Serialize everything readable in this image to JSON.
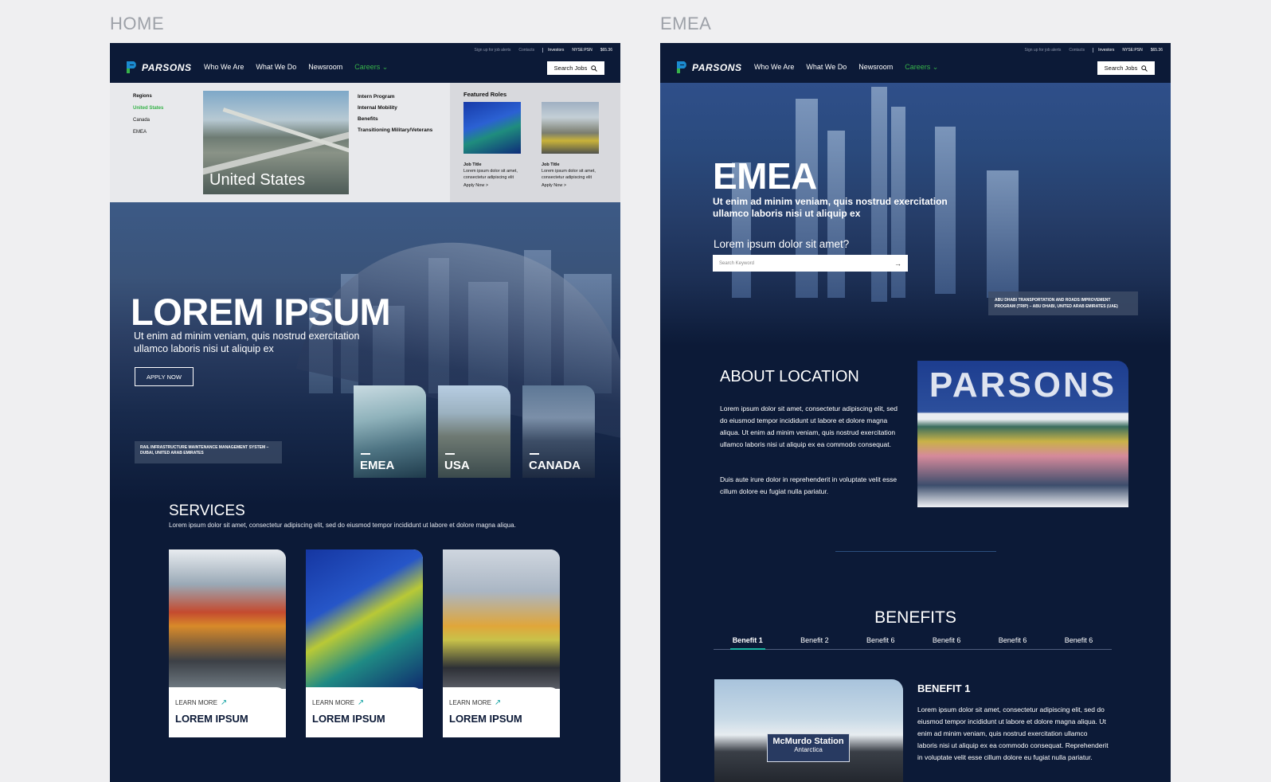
{
  "board_labels": {
    "home": "HOME",
    "emea": "EMEA"
  },
  "nav": {
    "utility": [
      "Sign up for job alerts",
      "Contacts",
      "Investors",
      "NYSE:PSN",
      "$65.36"
    ],
    "logo": "PARSONS",
    "menu": [
      "Who We Are",
      "What We Do",
      "Newsroom",
      "Careers"
    ],
    "careers_chevron": "⌄",
    "search_label": "Search Jobs"
  },
  "mega_menu": {
    "regions_heading": "Regions",
    "regions": [
      "United States",
      "Canada",
      "EMEA"
    ],
    "image_caption": "United States",
    "links": [
      "Intern Program",
      "Internal Mobility",
      "Benefits",
      "Transitioning Military/Veterans"
    ],
    "featured_title": "Featured Roles",
    "roles": [
      {
        "title": "Job Title",
        "desc": "Lorem ipsum dolor sit amet, consectetur adipiscing elit",
        "apply": "Apply Now >"
      },
      {
        "title": "Job Title",
        "desc": "Lorem ipsum dolor sit amet, consectetur adipiscing elit",
        "apply": "Apply Now >"
      }
    ]
  },
  "home_hero": {
    "title": "LOREM IPSUM",
    "subtitle": "Ut enim ad minim veniam, quis nostrud exercitation ullamco laboris nisi ut aliquip ex",
    "button": "APPLY NOW",
    "caption": "RAIL INFRASTRUCTURE MAINTENANCE MANAGEMENT SYSTEM – DUBAI, UNITED ARAB EMIRATES",
    "locations": [
      "EMEA",
      "USA",
      "CANADA"
    ]
  },
  "services": {
    "title": "SERVICES",
    "subtitle": "Lorem ipsum dolor sit amet, consectetur adipiscing elit, sed do eiusmod tempor incididunt ut labore et dolore magna aliqua.",
    "cards": [
      {
        "link": "LEARN MORE",
        "name": "LOREM IPSUM"
      },
      {
        "link": "LEARN MORE",
        "name": "LOREM IPSUM"
      },
      {
        "link": "LEARN MORE",
        "name": "LOREM IPSUM"
      }
    ],
    "arrow": "↗"
  },
  "emea_hero": {
    "title": "EMEA",
    "subtitle": "Ut enim ad minim veniam, quis nostrud exercitation ullamco laboris nisi ut aliquip ex",
    "question": "Lorem ipsum dolor sit amet?",
    "search_placeholder": "Search Keyword",
    "search_go": "→",
    "caption": "ABU DHABI TRANSPORTATION AND ROADS IMPROVEMENT PROGRAM (TRIP) – ABU DHABI, UNITED ARAB EMIRATES (UAE)"
  },
  "about": {
    "title": "ABOUT LOCATION",
    "p1": "Lorem ipsum dolor sit amet, consectetur adipiscing elit, sed do eiusmod tempor incididunt ut labore et dolore magna aliqua. Ut enim ad minim veniam, quis nostrud exercitation ullamco laboris nisi ut aliquip ex ea commodo consequat.",
    "p2": "Duis aute irure dolor in reprehenderit in voluptate velit esse cillum dolore eu fugiat nulla pariatur.",
    "photo_text": "PARSONS"
  },
  "benefits": {
    "title": "BENEFITS",
    "tabs": [
      "Benefit 1",
      "Benefit 2",
      "Benefit 6",
      "Benefit 6",
      "Benefit 6",
      "Benefit 6"
    ],
    "active_heading": "BENEFIT 1",
    "body": "Lorem ipsum dolor sit amet, consectetur adipiscing elit, sed do eiusmod tempor incididunt ut labore et dolore magna aliqua. Ut enim ad minim veniam, quis nostrud exercitation ullamco laboris nisi ut aliquip ex ea commodo consequat. Reprehenderit in voluptate velit esse cillum dolore eu fugiat nulla pariatur.",
    "sign_title": "McMurdo Station",
    "sign_sub": "Antarctica"
  },
  "colors": {
    "navy": "#0c1a37",
    "accent_green": "#37b34a",
    "accent_teal": "#1ab5a3"
  }
}
